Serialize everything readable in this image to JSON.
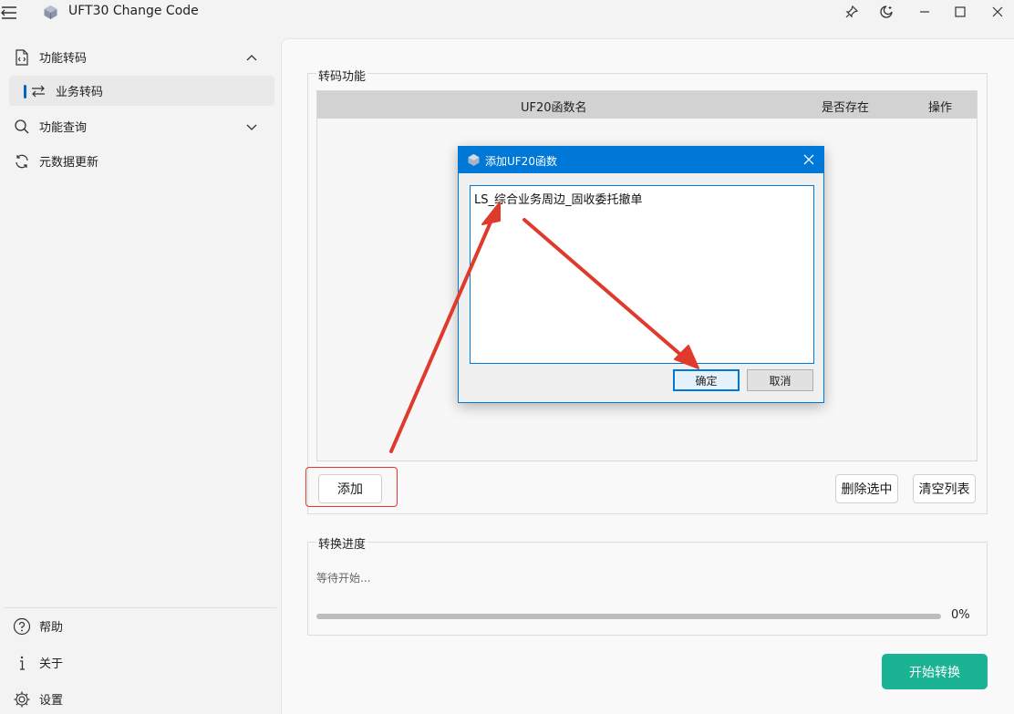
{
  "window": {
    "title": "UFT30 Change Code"
  },
  "sidebar": {
    "items": [
      {
        "label": "功能转码",
        "icon": "file-code-icon",
        "expanded": true
      },
      {
        "label": "业务转码",
        "icon": "swap-arrows-icon",
        "selected": true
      },
      {
        "label": "功能查询",
        "icon": "search-icon",
        "expanded": false
      },
      {
        "label": "元数据更新",
        "icon": "refresh-icon"
      }
    ],
    "footer": [
      {
        "label": "帮助",
        "icon": "help-icon"
      },
      {
        "label": "关于",
        "icon": "info-icon"
      },
      {
        "label": "设置",
        "icon": "gear-icon"
      }
    ]
  },
  "convert": {
    "group_title": "转码功能",
    "columns": [
      "UF20函数名",
      "是否存在",
      "操作"
    ],
    "add_button": "添加",
    "delete_button": "删除选中",
    "clear_button": "清空列表"
  },
  "progress": {
    "group_title": "转换进度",
    "status": "等待开始...",
    "value": 0,
    "label": "0%"
  },
  "start_button": "开始转换",
  "dialog": {
    "title": "添加UF20函数",
    "text": "LS_综合业务周边_固收委托撤单",
    "ok": "确定",
    "cancel": "取消"
  },
  "colors": {
    "accent": "#0067c0",
    "dialog_title": "#0078d7",
    "start_button": "#1ab394",
    "annotation": "#e03a2c"
  }
}
